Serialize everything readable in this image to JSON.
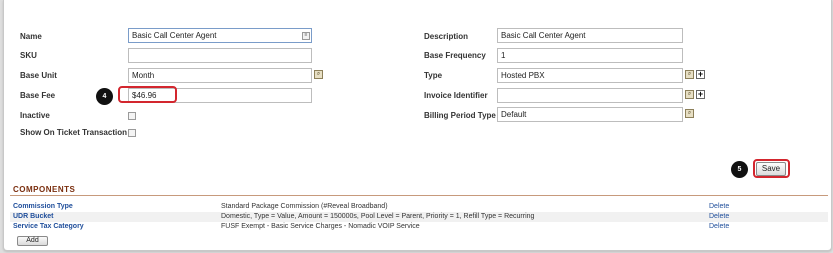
{
  "form": {
    "left": [
      {
        "label": "Name",
        "value": "Basic Call Center Agent"
      },
      {
        "label": "SKU",
        "value": ""
      },
      {
        "label": "Base Unit",
        "value": "Month"
      },
      {
        "label": "Base Fee",
        "value": "$46.96"
      },
      {
        "label": "Inactive"
      },
      {
        "label": "Show On Ticket Transaction"
      }
    ],
    "right": [
      {
        "label": "Description",
        "value": "Basic Call Center Agent"
      },
      {
        "label": "Base Frequency",
        "value": "1"
      },
      {
        "label": "Type",
        "value": "Hosted PBX"
      },
      {
        "label": "Invoice Identifier",
        "value": ""
      },
      {
        "label": "Billing Period Type",
        "value": "Default"
      }
    ]
  },
  "callouts": {
    "fee": "4",
    "save": "5"
  },
  "save_label": "Save",
  "components": {
    "title": "COMPONENTS",
    "rows": [
      {
        "name": "Commission Type",
        "value": "Standard Package Commission (#Reveal Broadband)",
        "action": "Delete"
      },
      {
        "name": "UDR Bucket",
        "value": "Domestic, Type = Value, Amount = 150000s, Pool Level = Parent, Priority = 1, Refill Type = Recurring",
        "action": "Delete"
      },
      {
        "name": "Service Tax Category",
        "value": "FUSF Exempt - Basic Service Charges - Nomadic VOIP Service",
        "action": "Delete"
      }
    ],
    "add_label": "Add"
  },
  "colors": {
    "highlight": "#d3262e",
    "section_title": "#7a2e0e",
    "link": "#1f4e9b"
  }
}
